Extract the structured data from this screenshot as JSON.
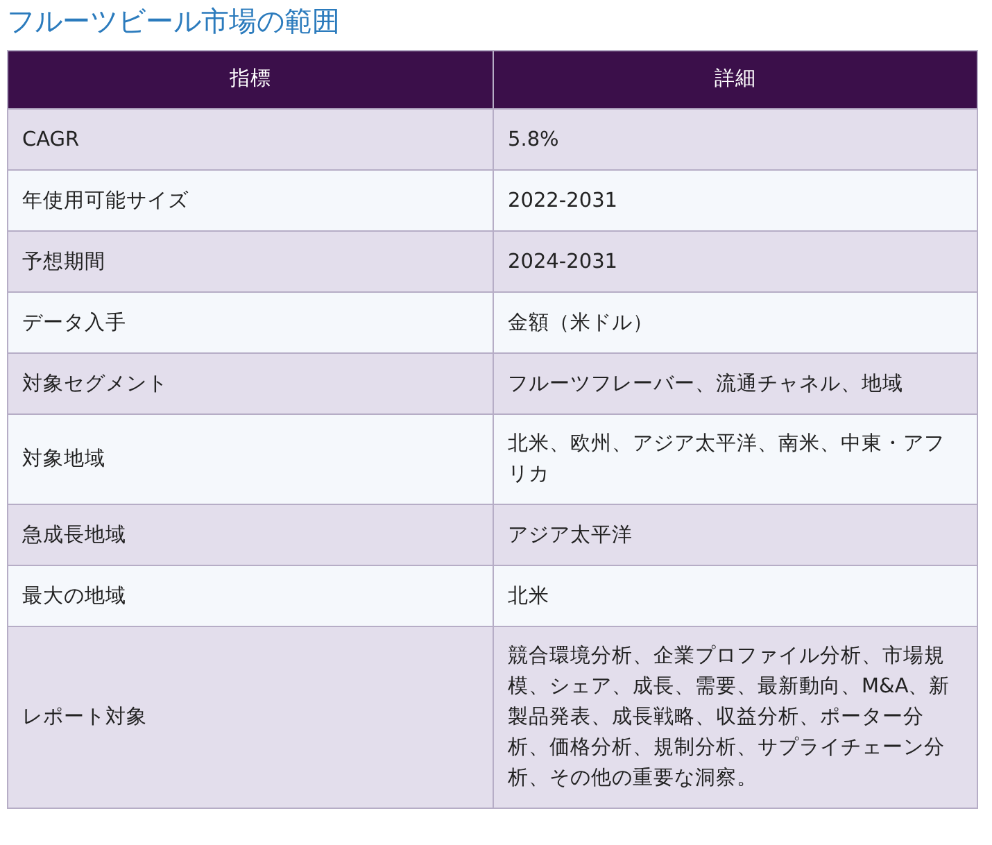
{
  "title": "フルーツビール市場の範囲",
  "table": {
    "columns": [
      "指標",
      "詳細"
    ],
    "rows": [
      {
        "cells": [
          "CAGR",
          "5.8%"
        ]
      },
      {
        "cells": [
          "年使用可能サイズ",
          "2022-2031"
        ]
      },
      {
        "cells": [
          "予想期間",
          "2024-2031"
        ]
      },
      {
        "cells": [
          "データ入手",
          "金額（米ドル）"
        ]
      },
      {
        "cells": [
          "対象セグメント",
          "フルーツフレーバー、流通チャネル、地域"
        ]
      },
      {
        "cells": [
          "対象地域",
          "北米、欧州、アジア太平洋、南米、中東・アフリカ"
        ]
      },
      {
        "cells": [
          "急成長地域",
          "アジア太平洋"
        ]
      },
      {
        "cells": [
          "最大の地域",
          "北米"
        ]
      },
      {
        "cells": [
          "レポート対象",
          "競合環境分析、企業プロファイル分析、市場規模、シェア、成長、需要、最新動向、M&A、新製品発表、成長戦略、収益分析、ポーター分析、価格分析、規制分析、サプライチェーン分析、その他の重要な洞察。"
        ]
      }
    ]
  }
}
